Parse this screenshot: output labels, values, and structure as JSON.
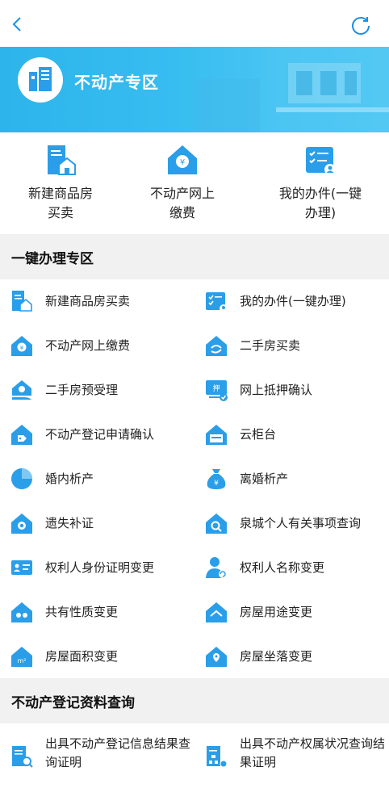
{
  "topbar": {
    "back_icon": "chevron-left-icon",
    "refresh_icon": "refresh-icon",
    "accent": "#1e8fe1"
  },
  "banner": {
    "title": "不动产专区",
    "logo_icon": "building-icon"
  },
  "quick_actions": [
    {
      "label_line1": "新建商品房",
      "label_line2": "买卖",
      "icon": "document-house-icon"
    },
    {
      "label_line1": "不动产网上",
      "label_line2": "缴费",
      "icon": "house-coin-icon"
    },
    {
      "label_line1": "我的办件(一键",
      "label_line2": "办理)",
      "icon": "checklist-user-icon"
    }
  ],
  "section_one_click": {
    "title": "一键办理专区"
  },
  "services": [
    {
      "label": "新建商品房买卖",
      "icon": "document-house-icon"
    },
    {
      "label": "我的办件(一键办理)",
      "icon": "checklist-user-icon"
    },
    {
      "label": "不动产网上缴费",
      "icon": "house-coin-icon"
    },
    {
      "label": "二手房买卖",
      "icon": "house-exchange-icon"
    },
    {
      "label": "二手房预受理",
      "icon": "house-hand-icon"
    },
    {
      "label": "网上抵押确认",
      "icon": "mortgage-monitor-icon"
    },
    {
      "label": "不动产登记申请确认",
      "icon": "house-tag-icon"
    },
    {
      "label": "云柜台",
      "icon": "house-counter-icon"
    },
    {
      "label": "婚内析产",
      "icon": "pie-chart-icon"
    },
    {
      "label": "离婚析产",
      "icon": "money-bag-icon"
    },
    {
      "label": "遗失补证",
      "icon": "house-certificate-icon"
    },
    {
      "label": "泉城个人有关事项查询",
      "icon": "house-search-icon"
    },
    {
      "label": "权利人身份证明变更",
      "icon": "id-card-icon"
    },
    {
      "label": "权利人名称变更",
      "icon": "user-refresh-icon"
    },
    {
      "label": "共有性质变更",
      "icon": "house-share-icon"
    },
    {
      "label": "房屋用途变更",
      "icon": "house-purpose-icon"
    },
    {
      "label": "房屋面积变更",
      "icon": "house-area-icon"
    },
    {
      "label": "房屋坐落变更",
      "icon": "house-location-icon"
    }
  ],
  "section_query": {
    "title": "不动产登记资料查询"
  },
  "query_items": [
    {
      "label": "出具不动产登记信息结果查询证明",
      "icon": "document-search-icon"
    },
    {
      "label": "出具不动产权属状况查询结果证明",
      "icon": "document-network-icon"
    }
  ],
  "colors": {
    "icon_blue": "#2a9ee8",
    "section_bg": "#f1f1f1",
    "banner_blue": "#37bdf0"
  }
}
